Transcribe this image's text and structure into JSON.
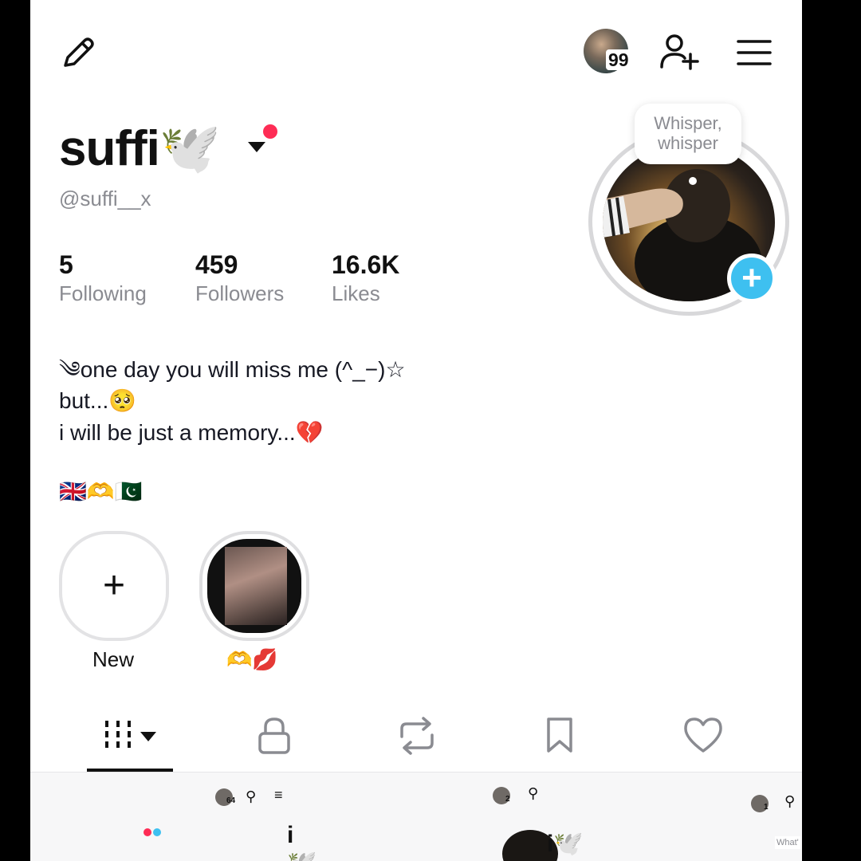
{
  "topbar": {
    "edit_icon": "pencil-icon",
    "notification_count": "99",
    "add_friend_icon": "person-add-icon",
    "menu_icon": "hamburger-menu-icon"
  },
  "profile": {
    "display_name": "suffi🕊️",
    "handle": "@suffi__x",
    "whisper_line1": "Whisper,",
    "whisper_line2": "whisper",
    "stats": [
      {
        "value": "5",
        "label": "Following"
      },
      {
        "value": "459",
        "label": "Followers"
      },
      {
        "value": "16.6K",
        "label": "Likes"
      }
    ],
    "bio": {
      "line1": "༄one day you will miss me (^_−)☆",
      "line2": "but...🥺",
      "line3": "i will be just a memory...💔",
      "line4": "🇬🇧🫶🇵🇰"
    }
  },
  "highlights": {
    "new_label": "New",
    "new_symbol": "+",
    "story_label": "🫶💋"
  },
  "tabs": {
    "videos": "grid-icon",
    "private": "lock-icon",
    "reposts": "repost-icon",
    "favorites": "bookmark-icon",
    "liked": "heart-icon"
  },
  "thumbnails": {
    "t1_name": "i🕊️",
    "t1_count": "64",
    "t2_count": "2",
    "t2_name": "i🕊️",
    "t3_count": "1",
    "t3_text": "What'"
  },
  "colors": {
    "accent_red": "#fe2c55",
    "accent_blue": "#3ec0f0",
    "muted_text": "#8a8b91"
  }
}
